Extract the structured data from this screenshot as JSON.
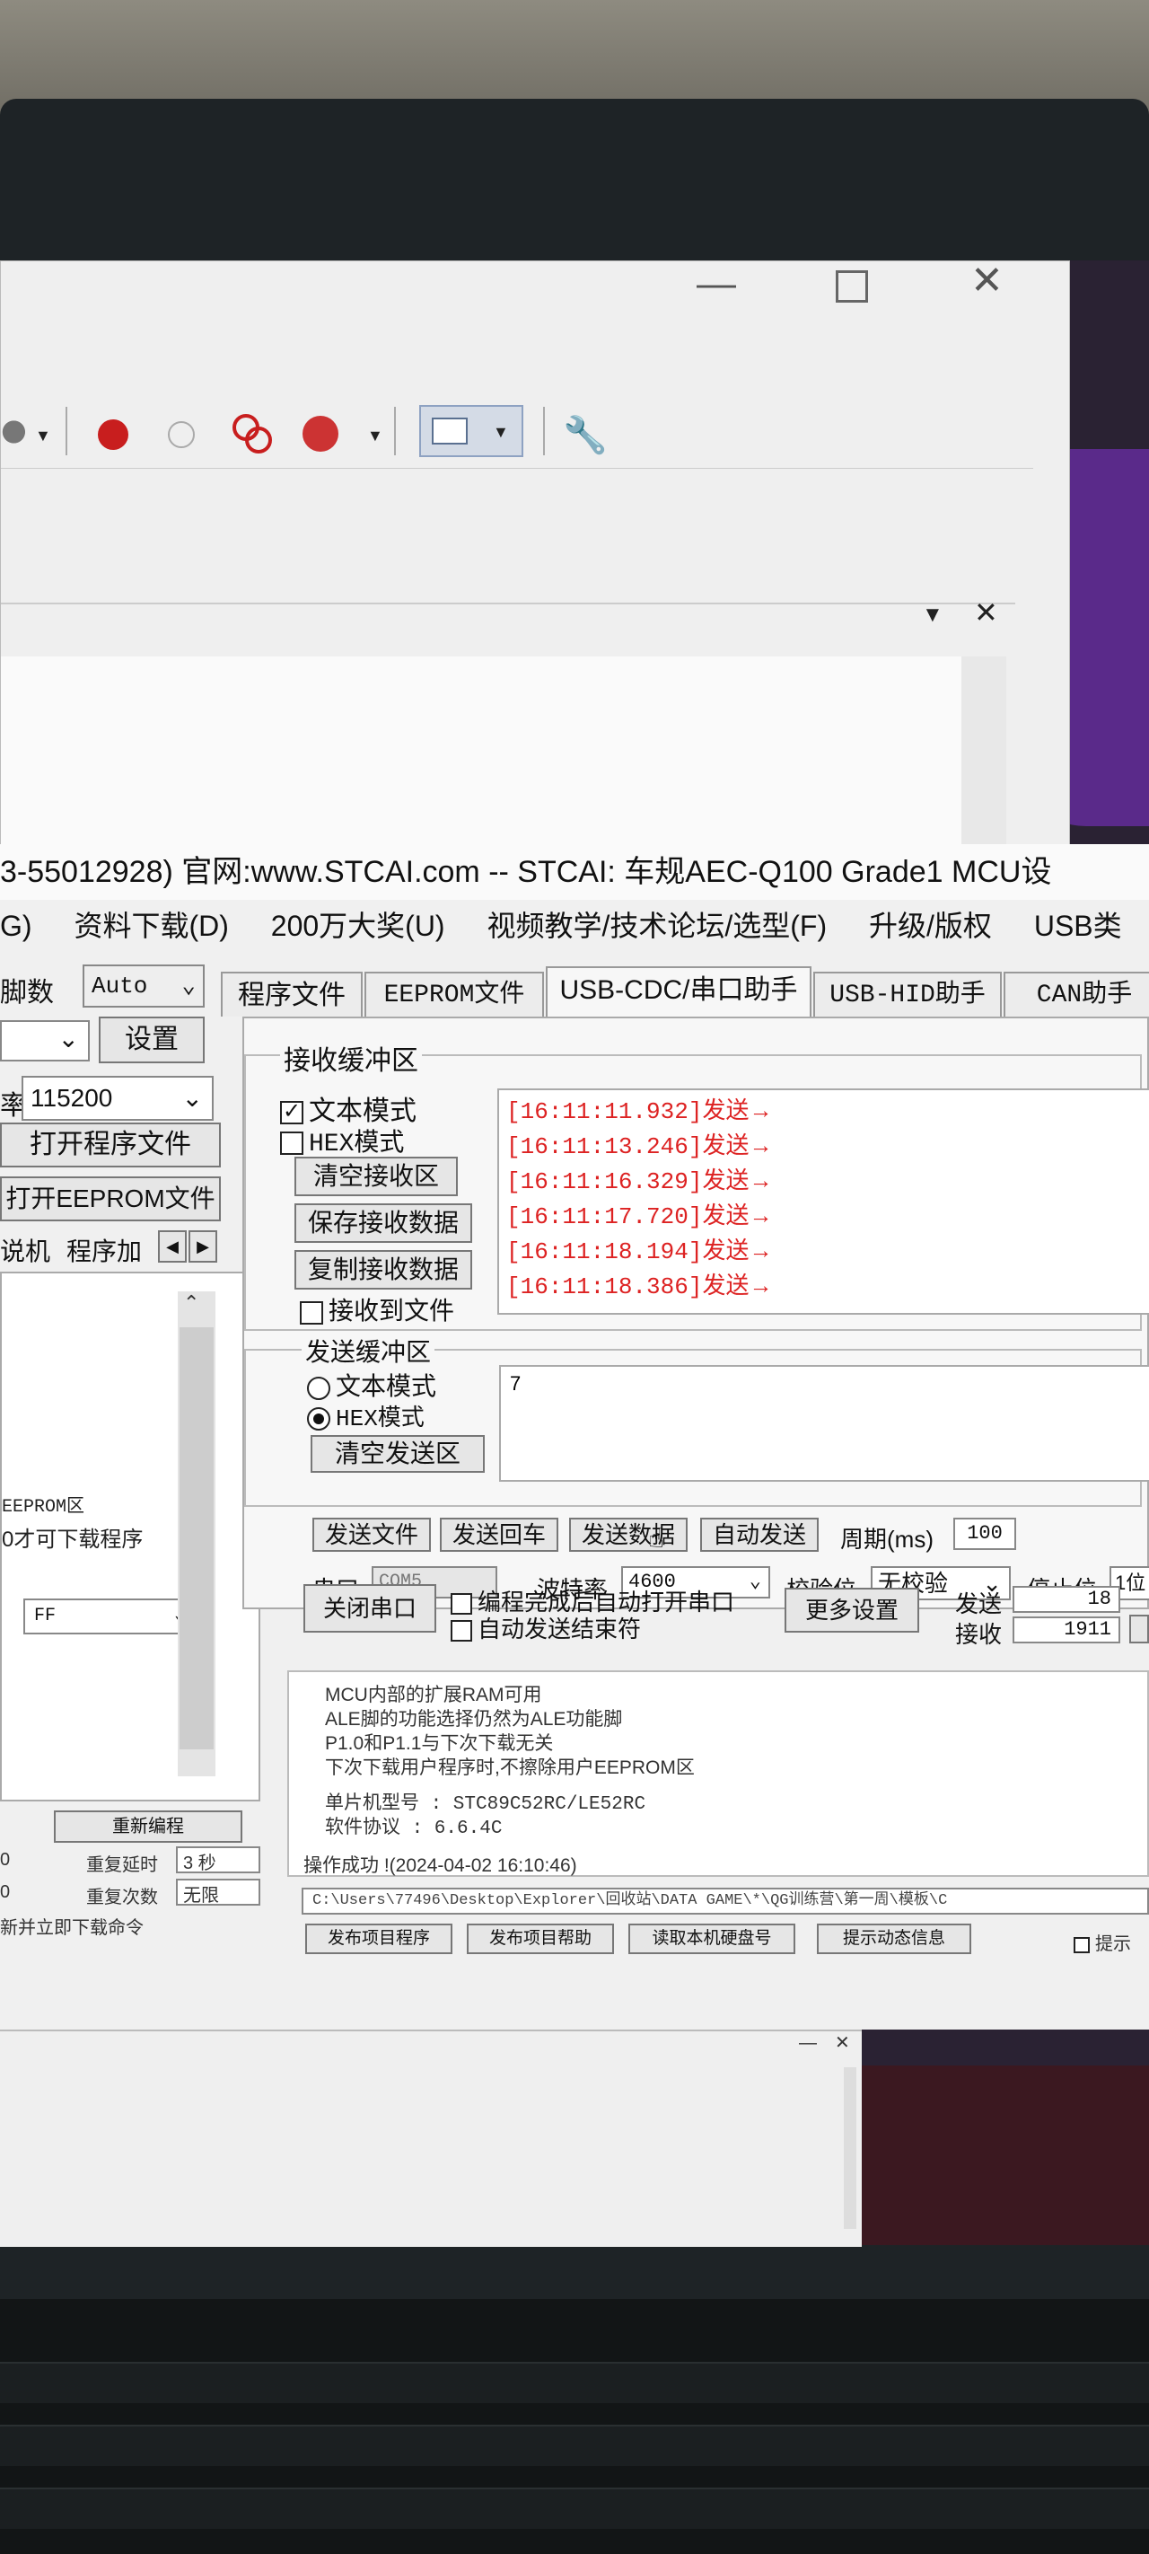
{
  "title_bar": "3-55012928) 官网:www.STCAI.com  -- STCAI: 车规AEC-Q100 Grade1 MCU设",
  "menu": [
    "G)",
    "资料下载(D)",
    "200万大奖(U)",
    "视频教学/技术论坛/选型(F)",
    "升级/版权",
    "USB类"
  ],
  "left": {
    "script_label": "脚数",
    "script_value": "Auto",
    "settings_btn": "设置",
    "baud_prefix": "率",
    "baud_value": "115200",
    "open_program": "打开程序文件",
    "open_eeprom": "打开EEPROM文件",
    "subtabs": [
      "说机",
      "程序加"
    ],
    "note1": "EEPROM区",
    "note2": "0才可下载程序",
    "ff_value": "FF",
    "bottom_btn": "重新编程",
    "row1": [
      "0",
      "重复延时",
      "3 秒"
    ],
    "row2": [
      "0",
      "重复次数",
      "无限"
    ],
    "row3": "新并立即下载命令"
  },
  "tabs": [
    "程序文件",
    "EEPROM文件",
    "USB-CDC/串口助手",
    "USB-HID助手",
    "CAN助手"
  ],
  "receive": {
    "group": "接收缓冲区",
    "text_mode": "文本模式",
    "hex_mode": "HEX模式",
    "clear": "清空接收区",
    "save": "保存接收数据",
    "copy": "复制接收数据",
    "to_file": "接收到文件",
    "log": [
      {
        "time": "[16:11:11.932]",
        "text": "发送→"
      },
      {
        "time": "[16:11:13.246]",
        "text": "发送→"
      },
      {
        "time": "[16:11:16.329]",
        "text": "发送→"
      },
      {
        "time": "[16:11:17.720]",
        "text": "发送→"
      },
      {
        "time": "[16:11:18.194]",
        "text": "发送→"
      },
      {
        "time": "[16:11:18.386]",
        "text": "发送→"
      }
    ]
  },
  "send": {
    "group": "发送缓冲区",
    "text_mode": "文本模式",
    "hex_mode": "HEX模式",
    "clear": "清空发送区",
    "content": "7",
    "send_file": "发送文件",
    "send_return": "发送回车",
    "send_data": "发送数据",
    "auto_send": "自动发送",
    "period_label": "周期(ms)",
    "period_value": "100"
  },
  "port": {
    "port_label": "串口",
    "port_value": "COM5",
    "baud_label": "波特率",
    "baud_value": "4600",
    "parity_label": "校验位",
    "parity_value": "无校验",
    "stop_label": "停止位",
    "stop_value": "1位",
    "close_btn": "关闭串口",
    "auto_open": "编程完成后自动打开串口",
    "auto_end": "自动发送结束符",
    "more": "更多设置",
    "sent_label": "发送",
    "sent_value": "18",
    "recv_label": "接收",
    "recv_value": "1911"
  },
  "info": [
    "MCU内部的扩展RAM可用",
    "ALE脚的功能选择仍然为ALE功能脚",
    "P1.0和P1.1与下次下载无关",
    "下次下载用户程序时,不擦除用户EEPROM区",
    "",
    "单片机型号 : STC89C52RC/LE52RC",
    "软件协议 : 6.6.4C",
    "",
    "操作成功 !(2024-04-02 16:10:46)"
  ],
  "path": "C:\\Users\\77496\\Desktop\\Explorer\\回收站\\DATA GAME\\*\\QG训练营\\第一周\\模板\\C",
  "footer_buttons": [
    "发布项目程序",
    "发布项目帮助",
    "读取本机硬盘号",
    "提示动态信息"
  ],
  "footer_check": "提示"
}
